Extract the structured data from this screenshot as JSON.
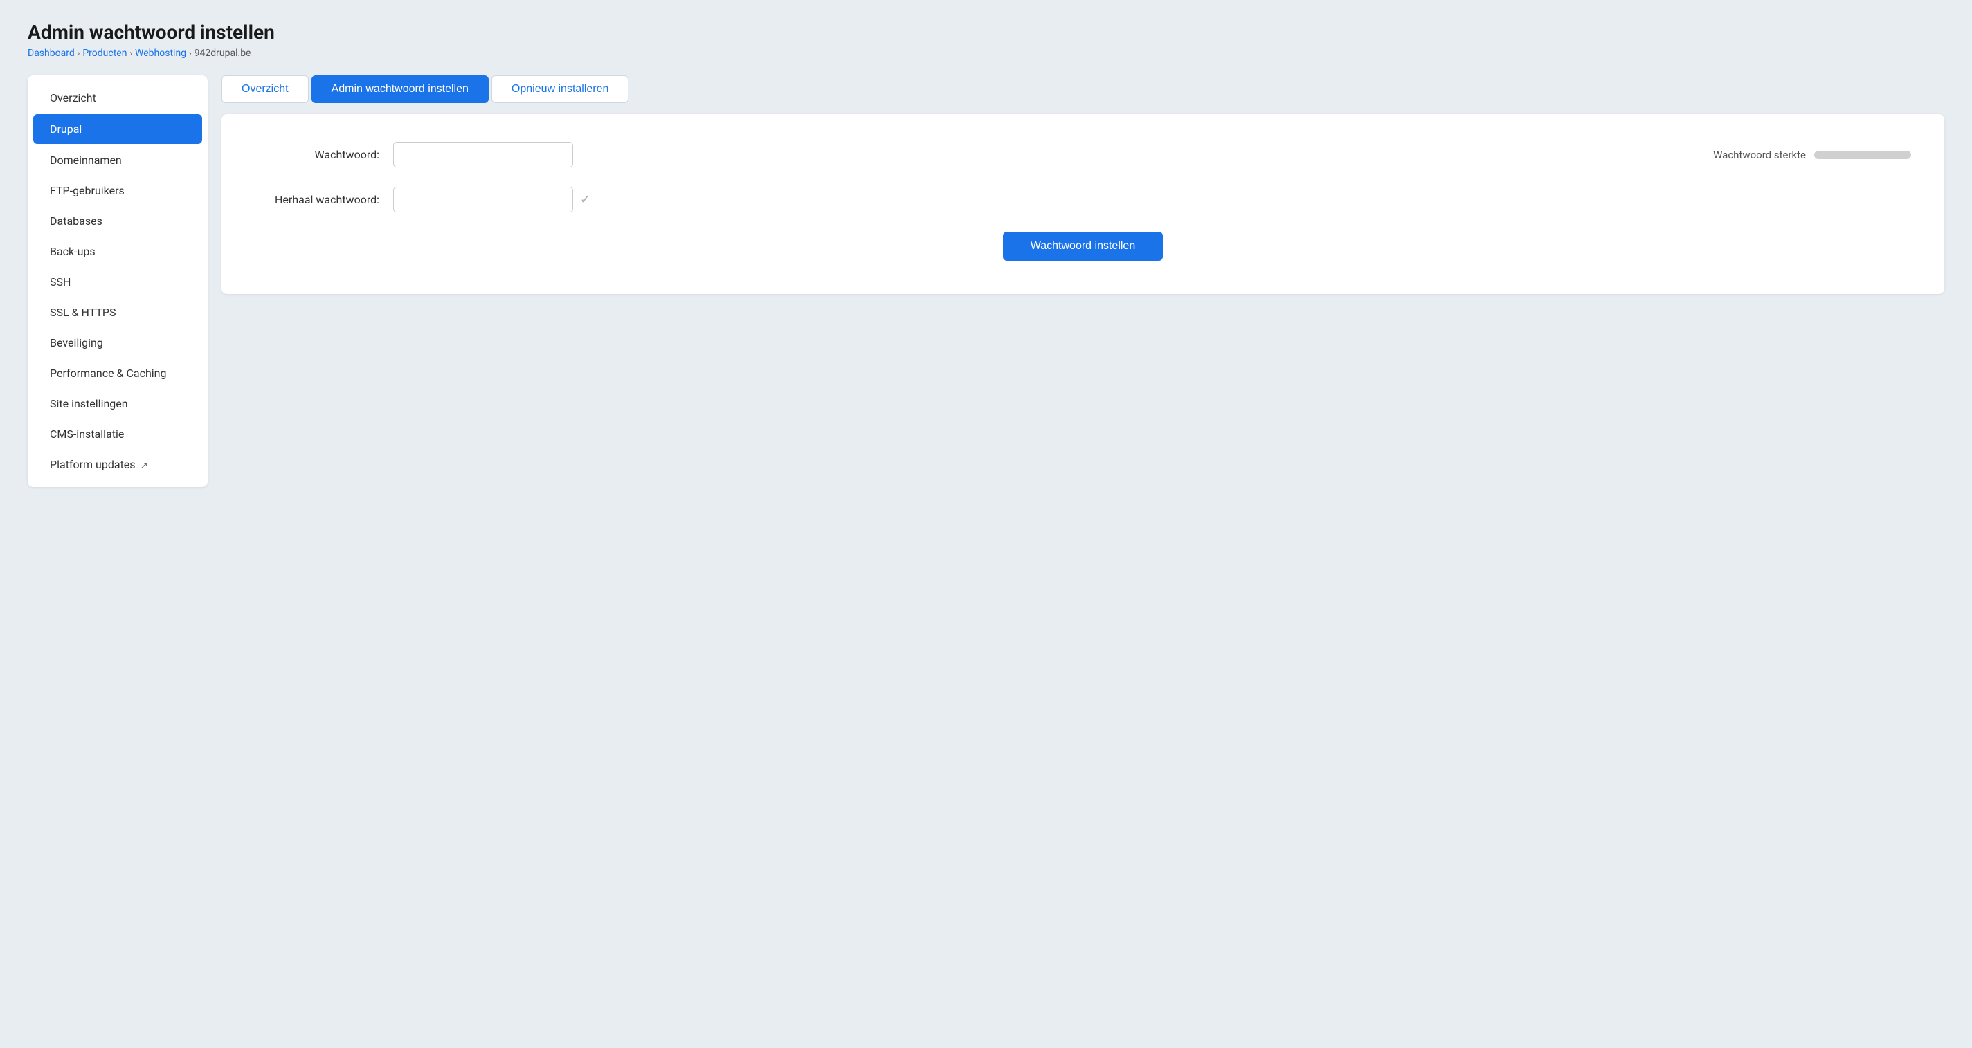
{
  "page": {
    "title": "Admin wachtwoord instellen"
  },
  "breadcrumb": {
    "items": [
      {
        "label": "Dashboard",
        "href": "#"
      },
      {
        "label": "Producten",
        "href": "#"
      },
      {
        "label": "Webhosting",
        "href": "#"
      },
      {
        "label": "942drupal.be",
        "href": null
      }
    ],
    "separator": "›"
  },
  "sidebar": {
    "items": [
      {
        "label": "Overzicht",
        "active": false,
        "external": false
      },
      {
        "label": "Drupal",
        "active": true,
        "external": false
      },
      {
        "label": "Domeinnamen",
        "active": false,
        "external": false
      },
      {
        "label": "FTP-gebruikers",
        "active": false,
        "external": false
      },
      {
        "label": "Databases",
        "active": false,
        "external": false
      },
      {
        "label": "Back-ups",
        "active": false,
        "external": false
      },
      {
        "label": "SSH",
        "active": false,
        "external": false
      },
      {
        "label": "SSL & HTTPS",
        "active": false,
        "external": false
      },
      {
        "label": "Beveiliging",
        "active": false,
        "external": false
      },
      {
        "label": "Performance & Caching",
        "active": false,
        "external": false
      },
      {
        "label": "Site instellingen",
        "active": false,
        "external": false
      },
      {
        "label": "CMS-installatie",
        "active": false,
        "external": false
      },
      {
        "label": "Platform updates",
        "active": false,
        "external": true
      }
    ]
  },
  "tabs": [
    {
      "label": "Overzicht",
      "active": false
    },
    {
      "label": "Admin wachtwoord instellen",
      "active": true
    },
    {
      "label": "Opnieuw installeren",
      "active": false
    }
  ],
  "form": {
    "password_label": "Wachtwoord:",
    "password_placeholder": "",
    "repeat_label": "Herhaal wachtwoord:",
    "repeat_placeholder": "",
    "strength_label": "Wachtwoord sterkte",
    "submit_label": "Wachtwoord instellen"
  }
}
